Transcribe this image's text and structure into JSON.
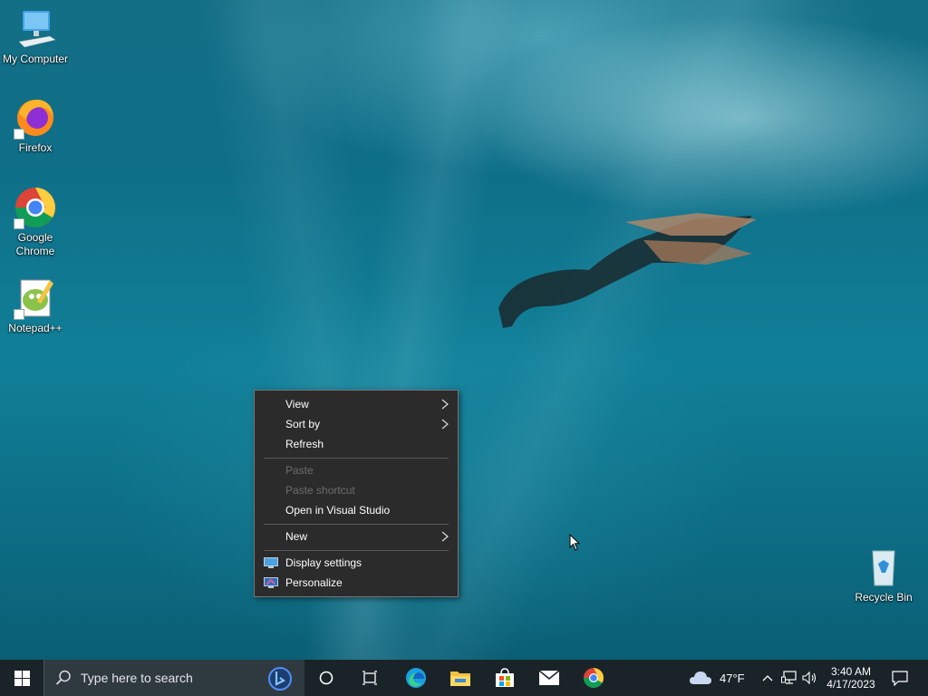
{
  "desktop": {
    "icons": [
      {
        "label": "My Computer"
      },
      {
        "label": "Firefox"
      },
      {
        "label_line1": "Google",
        "label_line2": "Chrome"
      },
      {
        "label": "Notepad++"
      },
      {
        "label": "Recycle Bin"
      }
    ]
  },
  "context_menu": {
    "items": [
      {
        "label": "View",
        "submenu": true
      },
      {
        "label": "Sort by",
        "submenu": true
      },
      {
        "label": "Refresh"
      },
      {
        "label": "Paste",
        "disabled": true
      },
      {
        "label": "Paste shortcut",
        "disabled": true
      },
      {
        "label": "Open in Visual Studio"
      },
      {
        "label": "New",
        "submenu": true
      },
      {
        "label": "Display settings",
        "icon": "display-icon"
      },
      {
        "label": "Personalize",
        "icon": "personalize-icon"
      }
    ]
  },
  "taskbar": {
    "search_placeholder": "Type here to search",
    "apps": [
      "cortana-icon",
      "task-view-icon",
      "edge-icon",
      "file-explorer-icon",
      "store-icon",
      "mail-icon",
      "chrome-icon"
    ],
    "weather": {
      "temp": "47°F",
      "icon": "cloud-icon"
    },
    "clock": {
      "time": "3:40 AM",
      "date": "4/17/2023"
    }
  },
  "colors": {
    "taskbar": "#1a2328",
    "menu_bg": "#2b2b2b",
    "menu_disabled": "#6d6d6d"
  }
}
